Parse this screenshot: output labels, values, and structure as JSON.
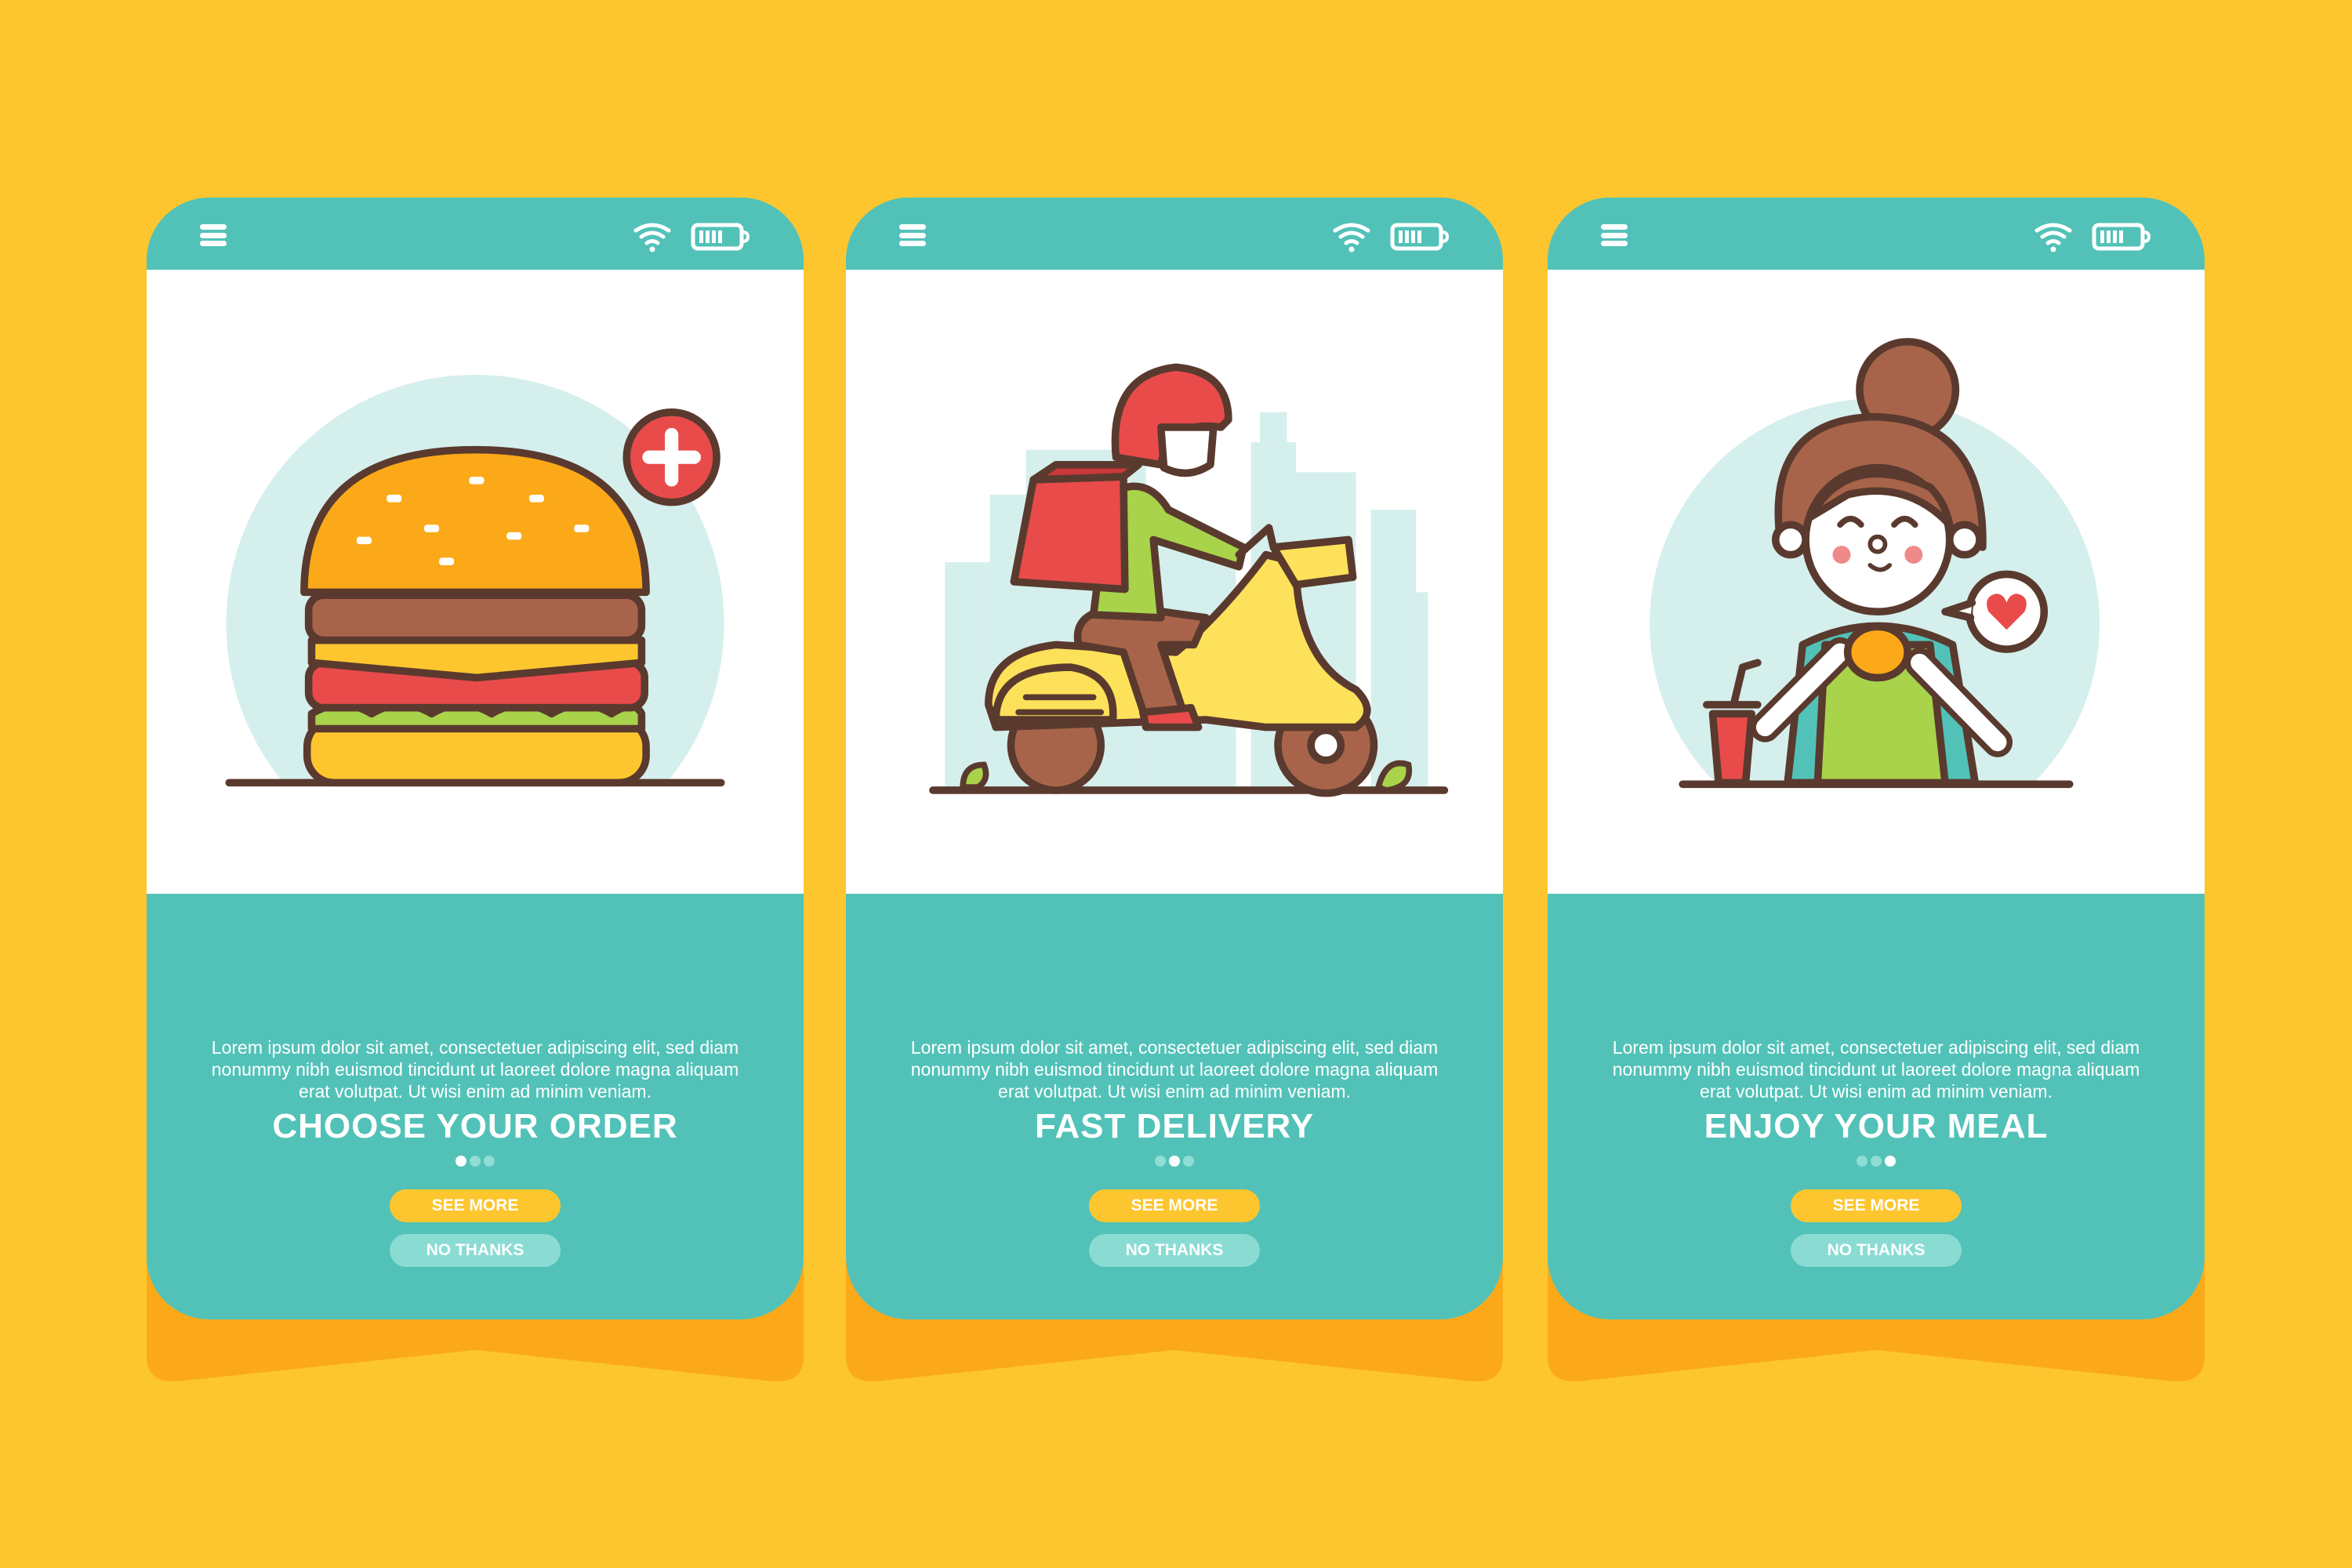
{
  "colors": {
    "background": "#FDC62F",
    "teal": "#52C2B8",
    "shadow": "#FBA919",
    "button_primary": "#FDC62F",
    "button_secondary": "#8ADCD3"
  },
  "status_icons": [
    "menu-icon",
    "wifi-icon",
    "battery-icon"
  ],
  "screens": [
    {
      "title": "CHOOSE YOUR ORDER",
      "body": "Lorem ipsum dolor sit amet, consectetuer adipiscing elit, sed diam nonummy nibh euismod tincidunt ut laoreet dolore magna aliquam erat volutpat. Ut wisi enim ad minim veniam.",
      "active_page": 1,
      "page_count": 3,
      "primary_button": "SEE MORE",
      "secondary_button": "NO THANKS",
      "illustration": "burger-icon"
    },
    {
      "title": "FAST DELIVERY",
      "body": "Lorem ipsum dolor sit amet, consectetuer adipiscing elit, sed diam nonummy nibh euismod tincidunt ut laoreet dolore magna aliquam erat volutpat. Ut wisi enim ad minim veniam.",
      "active_page": 2,
      "page_count": 3,
      "primary_button": "SEE MORE",
      "secondary_button": "NO THANKS",
      "illustration": "scooter-delivery-icon"
    },
    {
      "title": "ENJOY YOUR MEAL",
      "body": "Lorem ipsum dolor sit amet, consectetuer adipiscing elit, sed diam nonummy nibh euismod tincidunt ut laoreet dolore magna aliquam erat volutpat. Ut wisi enim ad minim veniam.",
      "active_page": 3,
      "page_count": 3,
      "primary_button": "SEE MORE",
      "secondary_button": "NO THANKS",
      "illustration": "girl-eating-icon"
    }
  ]
}
